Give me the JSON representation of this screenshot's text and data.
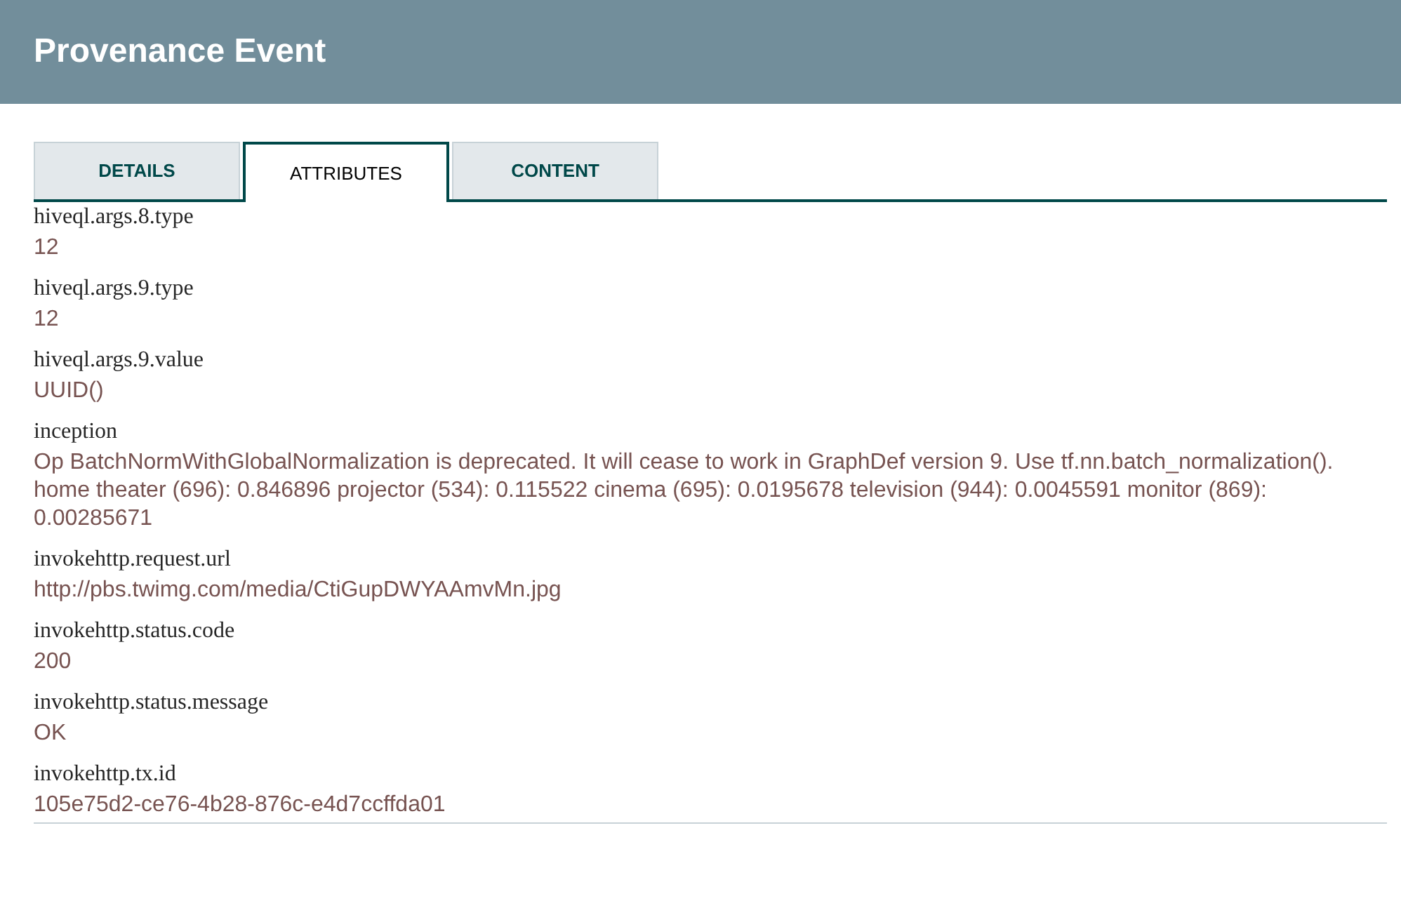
{
  "header": {
    "title": "Provenance Event"
  },
  "tabs": [
    {
      "label": "DETAILS",
      "selected": false
    },
    {
      "label": "ATTRIBUTES",
      "selected": true
    },
    {
      "label": "CONTENT",
      "selected": false
    }
  ],
  "attributes": [
    {
      "name": "hiveql.args.8.type",
      "value": "12"
    },
    {
      "name": "hiveql.args.9.type",
      "value": "12"
    },
    {
      "name": "hiveql.args.9.value",
      "value": "UUID()"
    },
    {
      "name": "inception",
      "value": "Op BatchNormWithGlobalNormalization is deprecated. It will cease to work in GraphDef version 9. Use tf.nn.batch_normalization(). home theater (696): 0.846896 projector (534): 0.115522 cinema (695): 0.0195678 television (944): 0.0045591 monitor (869): 0.00285671"
    },
    {
      "name": "invokehttp.request.url",
      "value": "http://pbs.twimg.com/media/CtiGupDWYAAmvMn.jpg"
    },
    {
      "name": "invokehttp.status.code",
      "value": "200"
    },
    {
      "name": "invokehttp.status.message",
      "value": "OK"
    },
    {
      "name": "invokehttp.tx.id",
      "value": "105e75d2-ce76-4b28-876c-e4d7ccffda01"
    }
  ]
}
